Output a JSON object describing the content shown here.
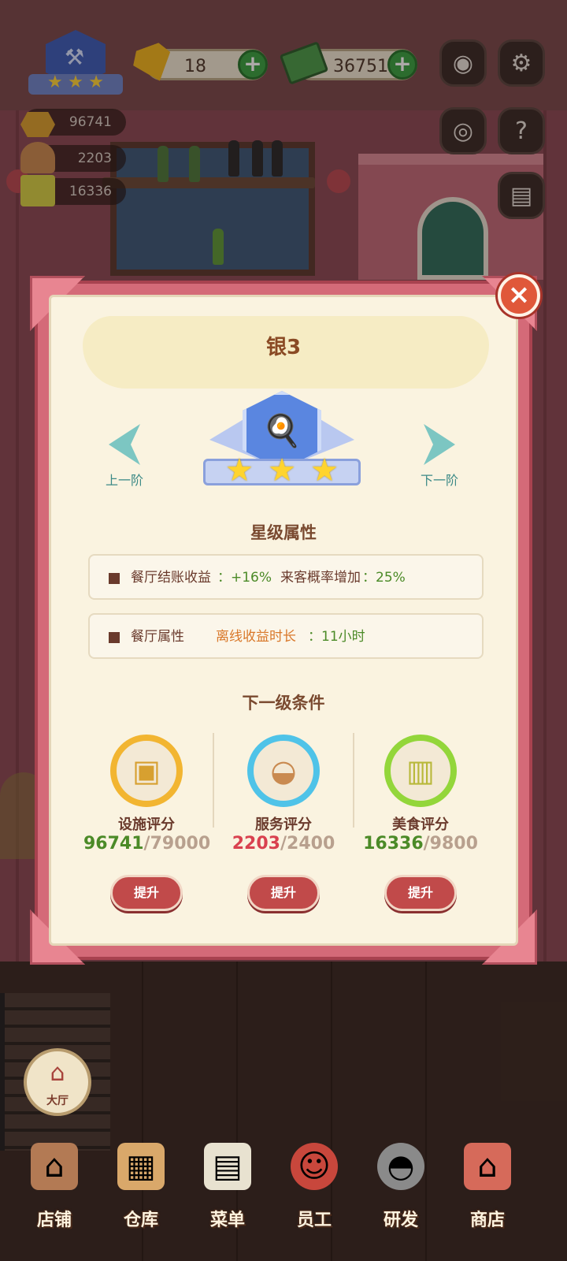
{
  "hud": {
    "gems": "18",
    "cash": "36751",
    "facility_score": "96741",
    "service_score": "2203",
    "food_score": "16336"
  },
  "modal": {
    "title": "银3",
    "prev_label": "上一阶",
    "next_label": "下一阶",
    "star_section_title": "星级属性",
    "properties": [
      {
        "label": "餐厅结账收益",
        "value": "：+16%",
        "extra_label": "来客概率增加",
        "extra_value": "：25%"
      },
      {
        "label": "餐厅属性",
        "value": "离线收益时长",
        "extra_value": "：11小时"
      }
    ],
    "next_section_title": "下一级条件",
    "requirements": [
      {
        "name": "设施评分",
        "current": "96741",
        "target": "/79000",
        "button": "提升",
        "ring_color": "#f2b531",
        "current_color": "#4b8a27"
      },
      {
        "name": "服务评分",
        "current": "2203",
        "target": "/2400",
        "button": "提升",
        "ring_color": "#4fc3e8",
        "current_color": "#d9414f"
      },
      {
        "name": "美食评分",
        "current": "16336",
        "target": "/9800",
        "button": "提升",
        "ring_color": "#93d63a",
        "current_color": "#4b8a27"
      }
    ]
  },
  "hall_label": "大厅",
  "bottom_nav": [
    {
      "label": "店铺"
    },
    {
      "label": "仓库"
    },
    {
      "label": "菜单"
    },
    {
      "label": "员工"
    },
    {
      "label": "研发"
    },
    {
      "label": "商店"
    }
  ]
}
